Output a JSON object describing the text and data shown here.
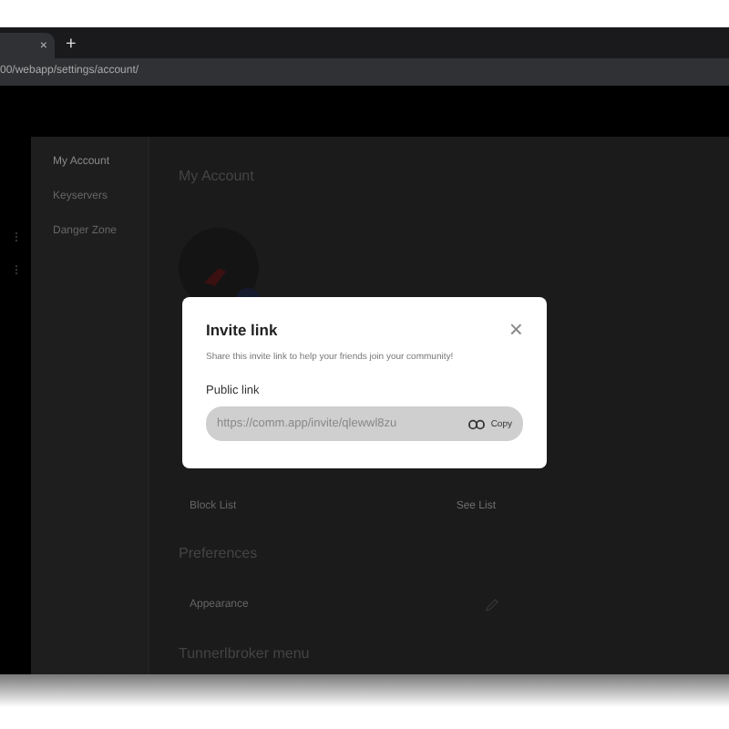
{
  "browser": {
    "tab_close": "×",
    "new_tab": "+",
    "address": "00/webapp/settings/account/"
  },
  "sidebar": {
    "items": [
      {
        "label": "My Account",
        "selected": true
      },
      {
        "label": "Keyservers",
        "selected": false
      },
      {
        "label": "Danger Zone",
        "selected": false
      }
    ]
  },
  "main": {
    "title": "My Account",
    "block_row": {
      "label": "Block List",
      "action": "See List"
    },
    "sections": [
      {
        "heading": "Preferences",
        "rows": [
          {
            "label": "Appearance",
            "kind": "edit"
          }
        ]
      },
      {
        "heading": "Tunnerlbroker menu"
      }
    ]
  },
  "modal": {
    "title": "Invite link",
    "close": "×",
    "description": "Share this invite link to help your friends join your community!",
    "field_label": "Public link",
    "link": "https://comm.app/invite/qlewwl8zu",
    "copy": "Copy"
  }
}
